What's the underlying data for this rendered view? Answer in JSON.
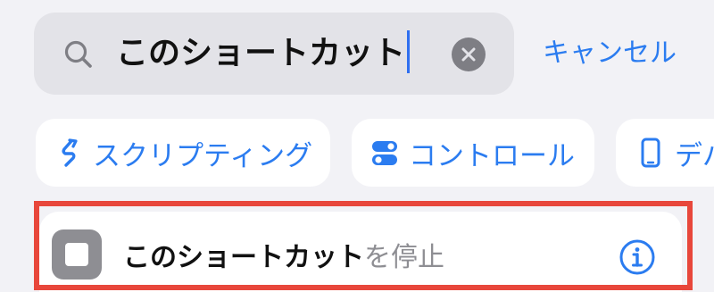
{
  "search": {
    "query": "このショートカット",
    "cancel_label": "キャンセル"
  },
  "categories": [
    {
      "label": "スクリプティング",
      "icon": "scripting-icon"
    },
    {
      "label": "コントロール",
      "icon": "toggle-icon"
    },
    {
      "label": "デバ",
      "icon": "device-icon"
    }
  ],
  "result": {
    "title_highlight": "このショートカット",
    "title_rest": "を停止",
    "icon": "stop-icon"
  },
  "colors": {
    "accent": "#2b7cf0",
    "highlight_frame": "#e8473b",
    "background": "#f2f2f6"
  }
}
